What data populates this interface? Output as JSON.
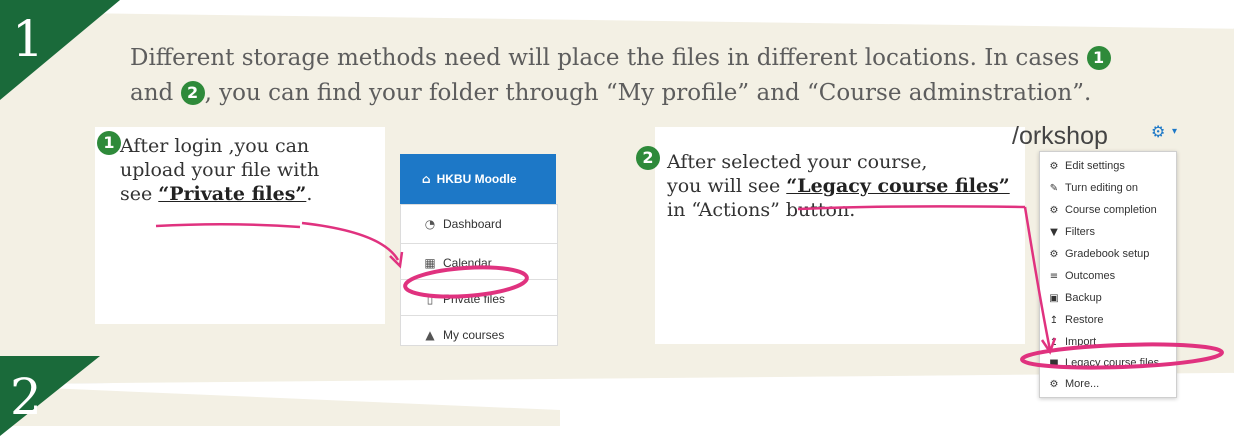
{
  "steps": [
    {
      "number": "1"
    },
    {
      "number": "2"
    }
  ],
  "intro": {
    "line1": "Different storage methods need will place the files in different locations. In cases",
    "line2_pre": "and",
    "line2_post": ", you can find your folder through “My profile” and “Course adminstration”.",
    "case1": "1",
    "case2": "2"
  },
  "panel1": {
    "marker": "1",
    "line1": "After login ,you can",
    "line2": "upload your file with",
    "line3_pre": "see",
    "line3_bold": "“Private files”",
    "line3_post": "."
  },
  "moodle_menu": {
    "header": "HKBU Moodle",
    "items": [
      {
        "label": "Dashboard",
        "icon": "dashboard-icon"
      },
      {
        "label": "Calendar",
        "icon": "calendar-icon"
      },
      {
        "label": "Private files",
        "icon": "file-icon"
      },
      {
        "label": "My courses",
        "icon": "graduation-cap-icon"
      }
    ]
  },
  "panel2": {
    "marker": "2",
    "line1": "After selected your course,",
    "line2_pre": "you will see",
    "line2_bold": "“Legacy course files”",
    "line3": "in “Actions” button."
  },
  "actions_menu": {
    "title": "/orkshop",
    "items": [
      {
        "label": "Edit settings",
        "icon": "gear-icon"
      },
      {
        "label": "Turn editing on",
        "icon": "pencil-icon"
      },
      {
        "label": "Course completion",
        "icon": "gear-icon"
      },
      {
        "label": "Filters",
        "icon": "filter-icon"
      },
      {
        "label": "Gradebook setup",
        "icon": "gear-icon"
      },
      {
        "label": "Outcomes",
        "icon": "list-icon"
      },
      {
        "label": "Backup",
        "icon": "backup-icon"
      },
      {
        "label": "Restore",
        "icon": "upload-icon"
      },
      {
        "label": "Import",
        "icon": "upload-icon"
      },
      {
        "label": "Legacy course files",
        "icon": "folder-icon"
      },
      {
        "label": "More...",
        "icon": "gear-icon"
      }
    ]
  },
  "colors": {
    "badge_green": "#1a6a3a",
    "marker_green": "#2e8a3a",
    "moodle_blue": "#1d78c7",
    "annotation_pink": "#e0327f",
    "card_bg": "#f3f0e4"
  }
}
